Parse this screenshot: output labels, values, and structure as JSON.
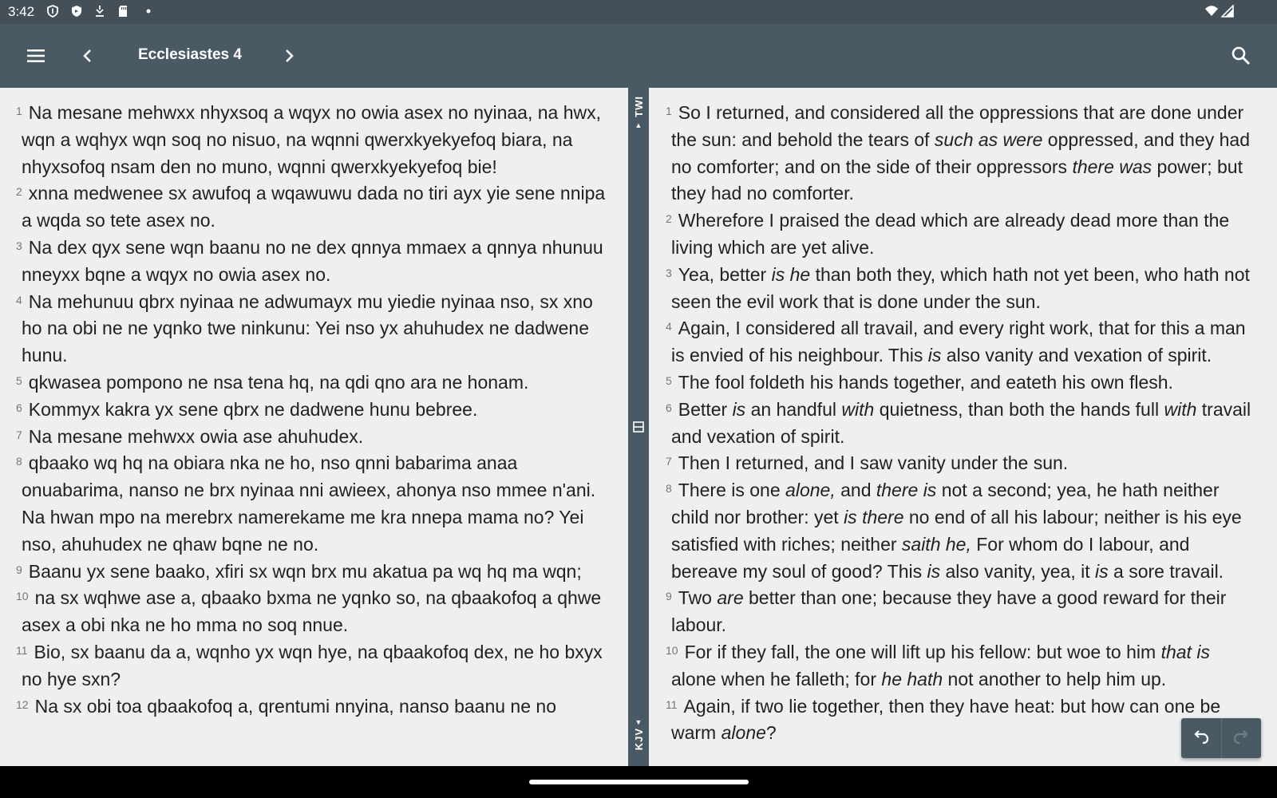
{
  "status": {
    "time": "3:42",
    "icons": [
      "shield-outline-icon",
      "shield-solid-icon",
      "vpn-key-icon",
      "sd-card-icon",
      "notification-dot-icon"
    ],
    "right_icons": [
      "wifi-icon",
      "cellular-signal-icon"
    ]
  },
  "appbar": {
    "title": "Ecclesiastes 4",
    "menu_icon": "menu-icon",
    "prev_icon": "chevron-left-icon",
    "next_icon": "chevron-right-icon",
    "search_icon": "search-icon",
    "background": "#4a5a64"
  },
  "divider": {
    "top_label": "TWI",
    "bottom_label": "KJV"
  },
  "left_pane": {
    "verses": [
      {
        "n": "1",
        "t": "Na mesane mehwxx nhyxsoq a wqyx no owia asex no nyinaa, na hwx, wqn a wqhyx wqn soq no nisuo, na wqnni qwerxkyekyefoq biara, na nhyxsofoq nsam den no muno, wqnni qwerxkyekyefoq bie!"
      },
      {
        "n": "2",
        "t": "xnna medwenee sx awufoq a wqawuwu dada no tiri ayx yie sene nnipa a wqda so tete asex no."
      },
      {
        "n": "3",
        "t": "Na dex qyx sene wqn baanu no ne dex qnnya mmaex a qnnya nhunuu nneyxx bqne a wqyx no owia asex no."
      },
      {
        "n": "4",
        "t": "Na mehunuu qbrx nyinaa ne adwumayx mu yiedie nyinaa nso, sx xno ho na obi ne ne yqnko twe ninkunu: Yei nso yx ahuhudex ne dadwene hunu."
      },
      {
        "n": "5",
        "t": "qkwasea pompono ne nsa tena hq, na qdi qno ara ne honam."
      },
      {
        "n": "6",
        "t": "Kommyx kakra yx sene qbrx ne dadwene hunu bebree."
      },
      {
        "n": "7",
        "t": "Na mesane mehwxx owia ase ahuhudex."
      },
      {
        "n": "8",
        "t": "qbaako wq hq na obiara nka ne ho, nso qnni babarima anaa onuabarima, nanso ne brx nyinaa nni awieex, ahonya nso mmee n'ani. Na hwan mpo na merebrx namerekame me kra nnepa mama no? Yei nso, ahuhudex ne qhaw bqne ne no."
      },
      {
        "n": "9",
        "t": "Baanu yx sene baako, xfiri sx wqn brx mu akatua pa wq hq ma wqn;"
      },
      {
        "n": "10",
        "t": "na sx wqhwe ase a, qbaako bxma ne yqnko so, na qbaakofoq a qhwe asex a obi nka ne ho mma no soq nnue."
      },
      {
        "n": "11",
        "t": "Bio, sx baanu da a, wqnho yx wqn hye, na qbaakofoq dex, ne ho bxyx no hye sxn?"
      },
      {
        "n": "12",
        "t": "Na sx obi toa qbaakofoq a, qrentumi nnyina, nanso baanu ne no"
      }
    ]
  },
  "right_pane": {
    "verses": [
      {
        "n": "1",
        "segs": [
          [
            "So I returned, and considered all the oppressions that are done under the sun: and behold the tears of ",
            false
          ],
          [
            "such as were",
            true
          ],
          [
            " oppressed, and they had no comforter; and on the side of their oppressors ",
            false
          ],
          [
            "there was",
            true
          ],
          [
            " power; but they had no comforter.",
            false
          ]
        ]
      },
      {
        "n": "2",
        "segs": [
          [
            "Wherefore I praised the dead which are already dead more than the living which are yet alive.",
            false
          ]
        ]
      },
      {
        "n": "3",
        "segs": [
          [
            "Yea, better ",
            false
          ],
          [
            "is he",
            true
          ],
          [
            " than both they, which hath not yet been, who hath not seen the evil work that is done under the sun.",
            false
          ]
        ]
      },
      {
        "n": "4",
        "segs": [
          [
            "Again, I considered all travail, and every right work, that for this a man is envied of his neighbour. This ",
            false
          ],
          [
            "is",
            true
          ],
          [
            " also vanity and vexation of spirit.",
            false
          ]
        ]
      },
      {
        "n": "5",
        "segs": [
          [
            "The fool foldeth his hands together, and eateth his own flesh.",
            false
          ]
        ]
      },
      {
        "n": "6",
        "segs": [
          [
            "Better ",
            false
          ],
          [
            "is",
            true
          ],
          [
            " an handful ",
            false
          ],
          [
            "with",
            true
          ],
          [
            " quietness, than both the hands full ",
            false
          ],
          [
            "with",
            true
          ],
          [
            " travail and vexation of spirit.",
            false
          ]
        ]
      },
      {
        "n": "7",
        "segs": [
          [
            "Then I returned, and I saw vanity under the sun.",
            false
          ]
        ]
      },
      {
        "n": "8",
        "segs": [
          [
            "There is one ",
            false
          ],
          [
            "alone,",
            true
          ],
          [
            " and ",
            false
          ],
          [
            "there is",
            true
          ],
          [
            " not a second; yea, he hath neither child nor brother: yet ",
            false
          ],
          [
            "is there",
            true
          ],
          [
            " no end of all his labour; neither is his eye satisfied with riches; neither ",
            false
          ],
          [
            "saith he,",
            true
          ],
          [
            " For whom do I labour, and bereave my soul of good? This ",
            false
          ],
          [
            "is",
            true
          ],
          [
            " also vanity, yea, it ",
            false
          ],
          [
            "is",
            true
          ],
          [
            " a sore travail.",
            false
          ]
        ]
      },
      {
        "n": "9",
        "segs": [
          [
            "Two ",
            false
          ],
          [
            "are",
            true
          ],
          [
            " better than one; because they have a good reward for their labour.",
            false
          ]
        ]
      },
      {
        "n": "10",
        "segs": [
          [
            "For if they fall, the one will lift up his fellow: but woe to him ",
            false
          ],
          [
            "that is",
            true
          ],
          [
            " alone when he falleth; for ",
            false
          ],
          [
            "he hath",
            true
          ],
          [
            " not another to help him up.",
            false
          ]
        ]
      },
      {
        "n": "11",
        "segs": [
          [
            "Again, if two lie together, then they have heat: but how can one be warm ",
            false
          ],
          [
            "alone",
            true
          ],
          [
            "?",
            false
          ]
        ]
      }
    ]
  },
  "float_controls": {
    "undo_icon": "undo-icon",
    "redo_icon": "redo-icon"
  }
}
